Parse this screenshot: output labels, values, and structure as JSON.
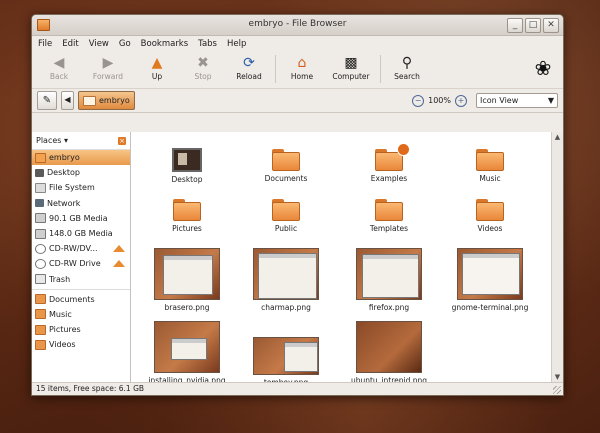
{
  "window": {
    "title": "embryo - File Browser"
  },
  "window_buttons": [
    "_",
    "□",
    "✕"
  ],
  "menu": [
    "File",
    "Edit",
    "View",
    "Go",
    "Bookmarks",
    "Tabs",
    "Help"
  ],
  "toolbar": {
    "back": "Back",
    "forward": "Forward",
    "up": "Up",
    "stop": "Stop",
    "reload": "Reload",
    "home": "Home",
    "computer": "Computer",
    "search": "Search"
  },
  "location": {
    "crumb": "embryo",
    "zoom": "100%",
    "view": "Icon View"
  },
  "sidebar": {
    "header": "Places",
    "places": [
      {
        "label": "embryo",
        "icon": "home"
      },
      {
        "label": "Desktop",
        "icon": "desktop"
      },
      {
        "label": "File System",
        "icon": "fs"
      },
      {
        "label": "Network",
        "icon": "net"
      },
      {
        "label": "90.1 GB Media",
        "icon": "drive"
      },
      {
        "label": "148.0 GB Media",
        "icon": "drive"
      },
      {
        "label": "CD-RW/DV...",
        "icon": "cd"
      },
      {
        "label": "CD-RW Drive",
        "icon": "cd"
      },
      {
        "label": "Trash",
        "icon": "trash"
      }
    ],
    "bookmarks": [
      {
        "label": "Documents"
      },
      {
        "label": "Music"
      },
      {
        "label": "Pictures"
      },
      {
        "label": "Videos"
      }
    ]
  },
  "files": [
    {
      "label": "Desktop"
    },
    {
      "label": "Documents"
    },
    {
      "label": "Examples"
    },
    {
      "label": "Music"
    },
    {
      "label": "Pictures"
    },
    {
      "label": "Public"
    },
    {
      "label": "Templates"
    },
    {
      "label": "Videos"
    },
    {
      "label": "brasero.png"
    },
    {
      "label": "charmap.png"
    },
    {
      "label": "firefox.png"
    },
    {
      "label": "gnome-terminal.png"
    },
    {
      "label": "installing_nvidia.png"
    },
    {
      "label": "tomboy.png"
    },
    {
      "label": "ubuntu_intrepid.png"
    }
  ],
  "status": "15 items, Free space: 6.1 GB"
}
